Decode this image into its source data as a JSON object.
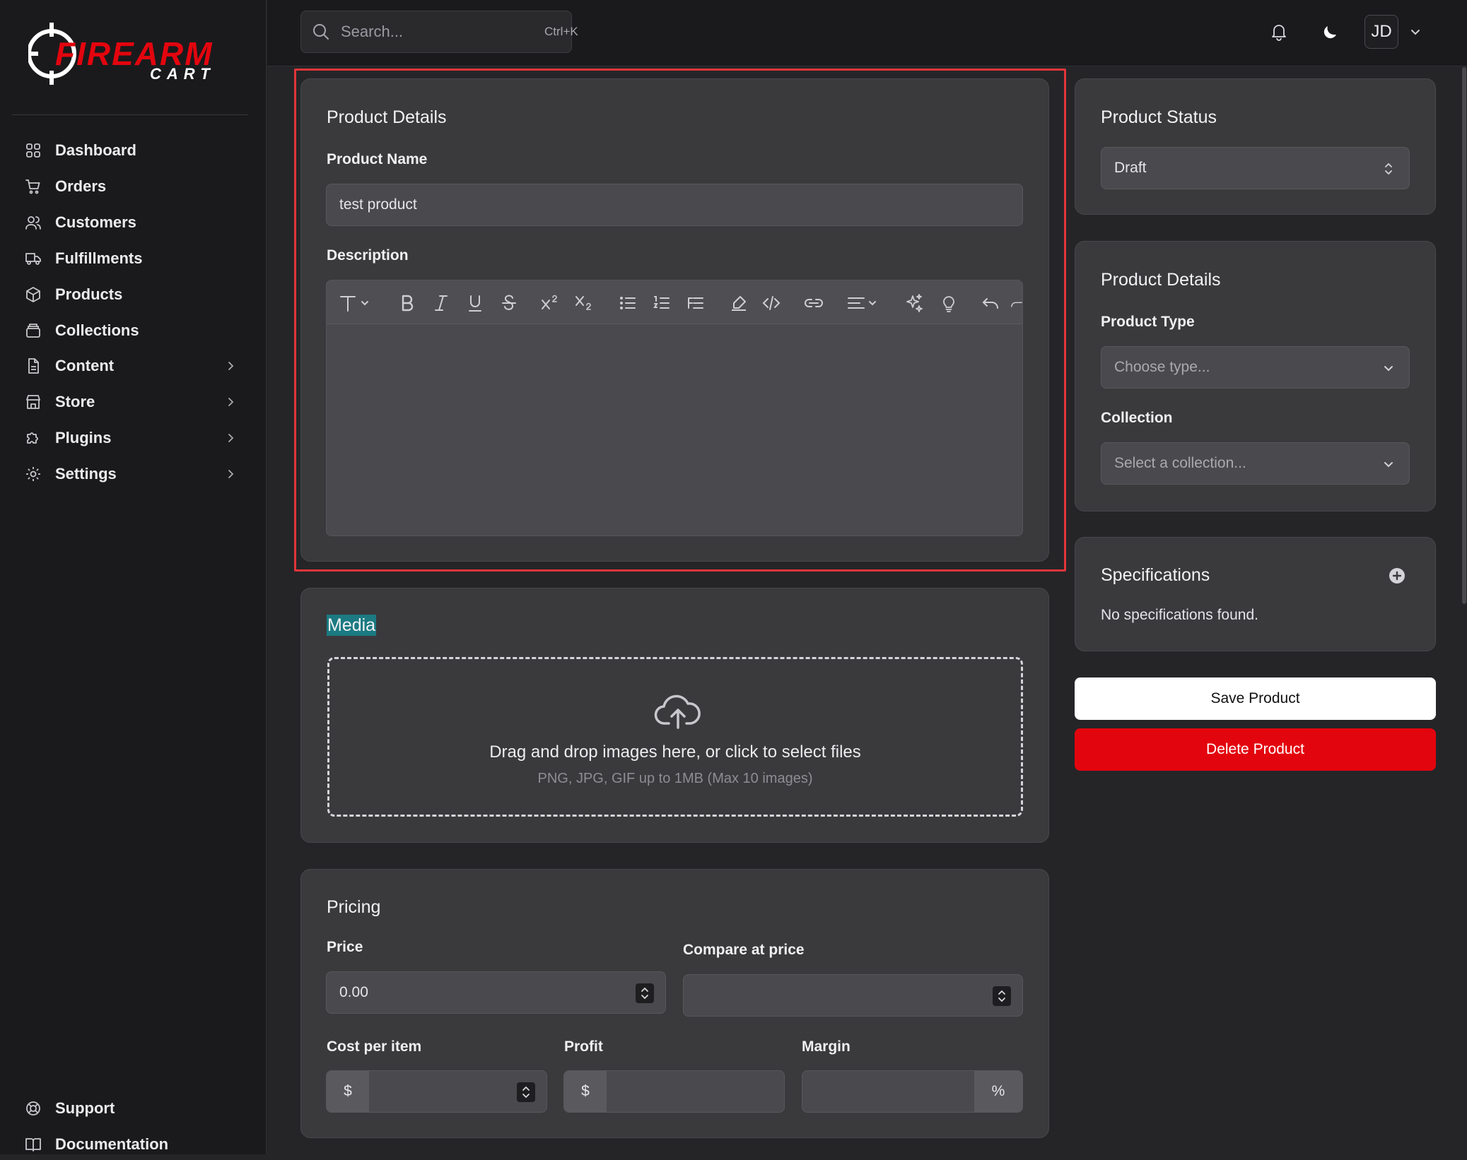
{
  "app": {
    "logo_top": "FIREARM",
    "logo_bottom": "CART",
    "accent_color": "#e3050e"
  },
  "sidebar": {
    "items": [
      {
        "label": "Dashboard",
        "icon": "grid-icon"
      },
      {
        "label": "Orders",
        "icon": "cart-icon"
      },
      {
        "label": "Customers",
        "icon": "users-icon"
      },
      {
        "label": "Fulfillments",
        "icon": "truck-icon"
      },
      {
        "label": "Products",
        "icon": "box-icon"
      },
      {
        "label": "Collections",
        "icon": "archive-icon"
      },
      {
        "label": "Content",
        "icon": "file-icon"
      },
      {
        "label": "Store",
        "icon": "store-icon"
      },
      {
        "label": "Plugins",
        "icon": "puzzle-icon"
      },
      {
        "label": "Settings",
        "icon": "gear-icon"
      }
    ],
    "footer": [
      {
        "label": "Support",
        "icon": "lifebuoy-icon"
      },
      {
        "label": "Documentation",
        "icon": "book-icon"
      }
    ]
  },
  "topbar": {
    "search_placeholder": "Search...",
    "search_shortcut": "Ctrl+K",
    "avatar_initials": "JD"
  },
  "product_details": {
    "title": "Product Details",
    "name_label": "Product Name",
    "name_value": "test product",
    "description_label": "Description"
  },
  "media": {
    "title": "Media",
    "drop_text": "Drag and drop images here, or click to select files",
    "drop_hint": "PNG, JPG, GIF up to 1MB (Max 10 images)"
  },
  "pricing": {
    "title": "Pricing",
    "price_label": "Price",
    "price_value": "0.00",
    "compare_label": "Compare at price",
    "compare_value": "",
    "cost_label": "Cost per item",
    "profit_label": "Profit",
    "margin_label": "Margin",
    "currency_symbol": "$",
    "percent_symbol": "%"
  },
  "status": {
    "title": "Product Status",
    "value": "Draft"
  },
  "side_details": {
    "title": "Product Details",
    "type_label": "Product Type",
    "type_placeholder": "Choose type...",
    "collection_label": "Collection",
    "collection_placeholder": "Select a collection..."
  },
  "specifications": {
    "title": "Specifications",
    "empty_text": "No specifications found."
  },
  "actions": {
    "save_label": "Save Product",
    "delete_label": "Delete Product"
  }
}
